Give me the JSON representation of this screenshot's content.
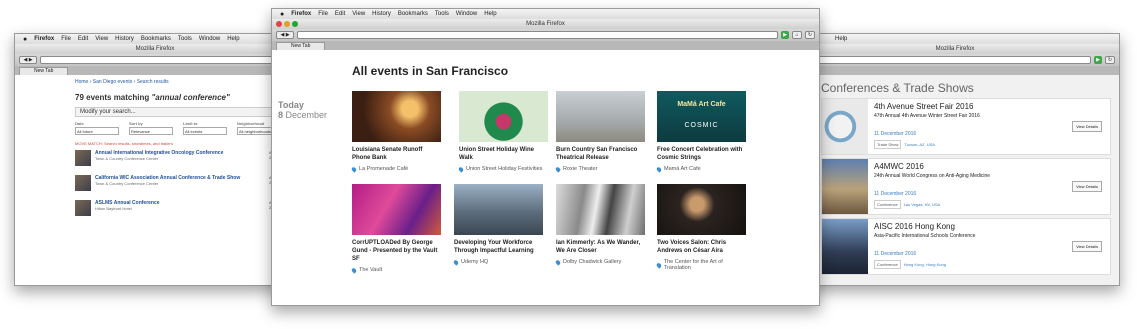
{
  "menu": {
    "apple": "",
    "browser": "Firefox",
    "items": [
      "File",
      "Edit",
      "View",
      "History",
      "Bookmarks",
      "Tools",
      "Window",
      "Help"
    ]
  },
  "window_title": "Mozilla Firefox",
  "tab_label": "New Tab",
  "left": {
    "crumb": "Home › San Diego events › Search results",
    "count_prefix": "79 events matching ",
    "count_query": "\"annual conference\"",
    "search_placeholder": "Modify your search...",
    "filters": [
      {
        "label": "Date",
        "value": "All future"
      },
      {
        "label": "Sort by",
        "value": "Relevance"
      },
      {
        "label": "Limit to",
        "value": "All events"
      },
      {
        "label": "Neighborhood",
        "value": "All neighborhoods"
      }
    ],
    "hint": "MOVE MATCH: Search results, showtimes, and trailers",
    "results": [
      {
        "title": "Annual International Integrative Oncology Conference",
        "sub": "Town & Country Conference Center",
        "date": "Apr 27, 2017"
      },
      {
        "title": "California WIC Association Annual Conference & Trade Show",
        "sub": "Town & Country Conference Center",
        "date": "Apr 28, 2017"
      },
      {
        "title": "ASLMS Annual Conference",
        "sub": "Hilton Bayfront Hotel",
        "date": "Apr 5, 2017"
      }
    ]
  },
  "main": {
    "heading": "All events in San Francisco",
    "day_label": "Today",
    "day_num": "8",
    "day_month": "December",
    "events": [
      {
        "title": "Louisiana Senate Runoff Phone Bank",
        "venue": "La Promenade Café"
      },
      {
        "title": "Union Street Holiday Wine Walk",
        "venue": "Union Street Holiday Festivities"
      },
      {
        "title": "Burn Country San Francisco Theatrical Release",
        "venue": "Roxie Theater"
      },
      {
        "title": "Free Concert Celebration with Cosmic Strings",
        "venue": "Mamá Art Cafe"
      },
      {
        "title": "CorrUPTLOADed By George Gund - Presented by the Vault SF",
        "venue": "The Vault"
      },
      {
        "title": "Developing Your Workforce Through Impactful Learning",
        "venue": "Udemy HQ"
      },
      {
        "title": "Ian Kimmerly: As We Wander, We Are Closer",
        "venue": "Dolby Chadwick Gallery"
      },
      {
        "title": "Two Voices Salon: Chris Andrews on César Aira",
        "venue": "The Center for the Art of Translation"
      }
    ],
    "poster_text": [
      "MaMá Art Cafe",
      "COSMIC"
    ]
  },
  "right": {
    "heading": "Conferences & Trade Shows",
    "events": [
      {
        "name": "4th Avenue Street Fair 2016",
        "desc": "47th Annual 4th Avenue Winter Street Fair 2016",
        "date": "11 December 2016",
        "tags": [
          "Trade Show",
          "Tucson, AZ, USA"
        ]
      },
      {
        "name": "A4MWC 2016",
        "desc": "24th Annual World Congress on Anti-Aging Medicine",
        "date": "11 December 2016",
        "tags": [
          "Conference",
          "Las Vegas, NV, USA"
        ]
      },
      {
        "name": "AISC 2016 Hong Kong",
        "desc": "Asia-Pacific International Schools Conference",
        "date": "11 December 2016",
        "tags": [
          "Conference",
          "Hong Kong, Hong Kong"
        ]
      }
    ],
    "view_details": "View Details"
  }
}
